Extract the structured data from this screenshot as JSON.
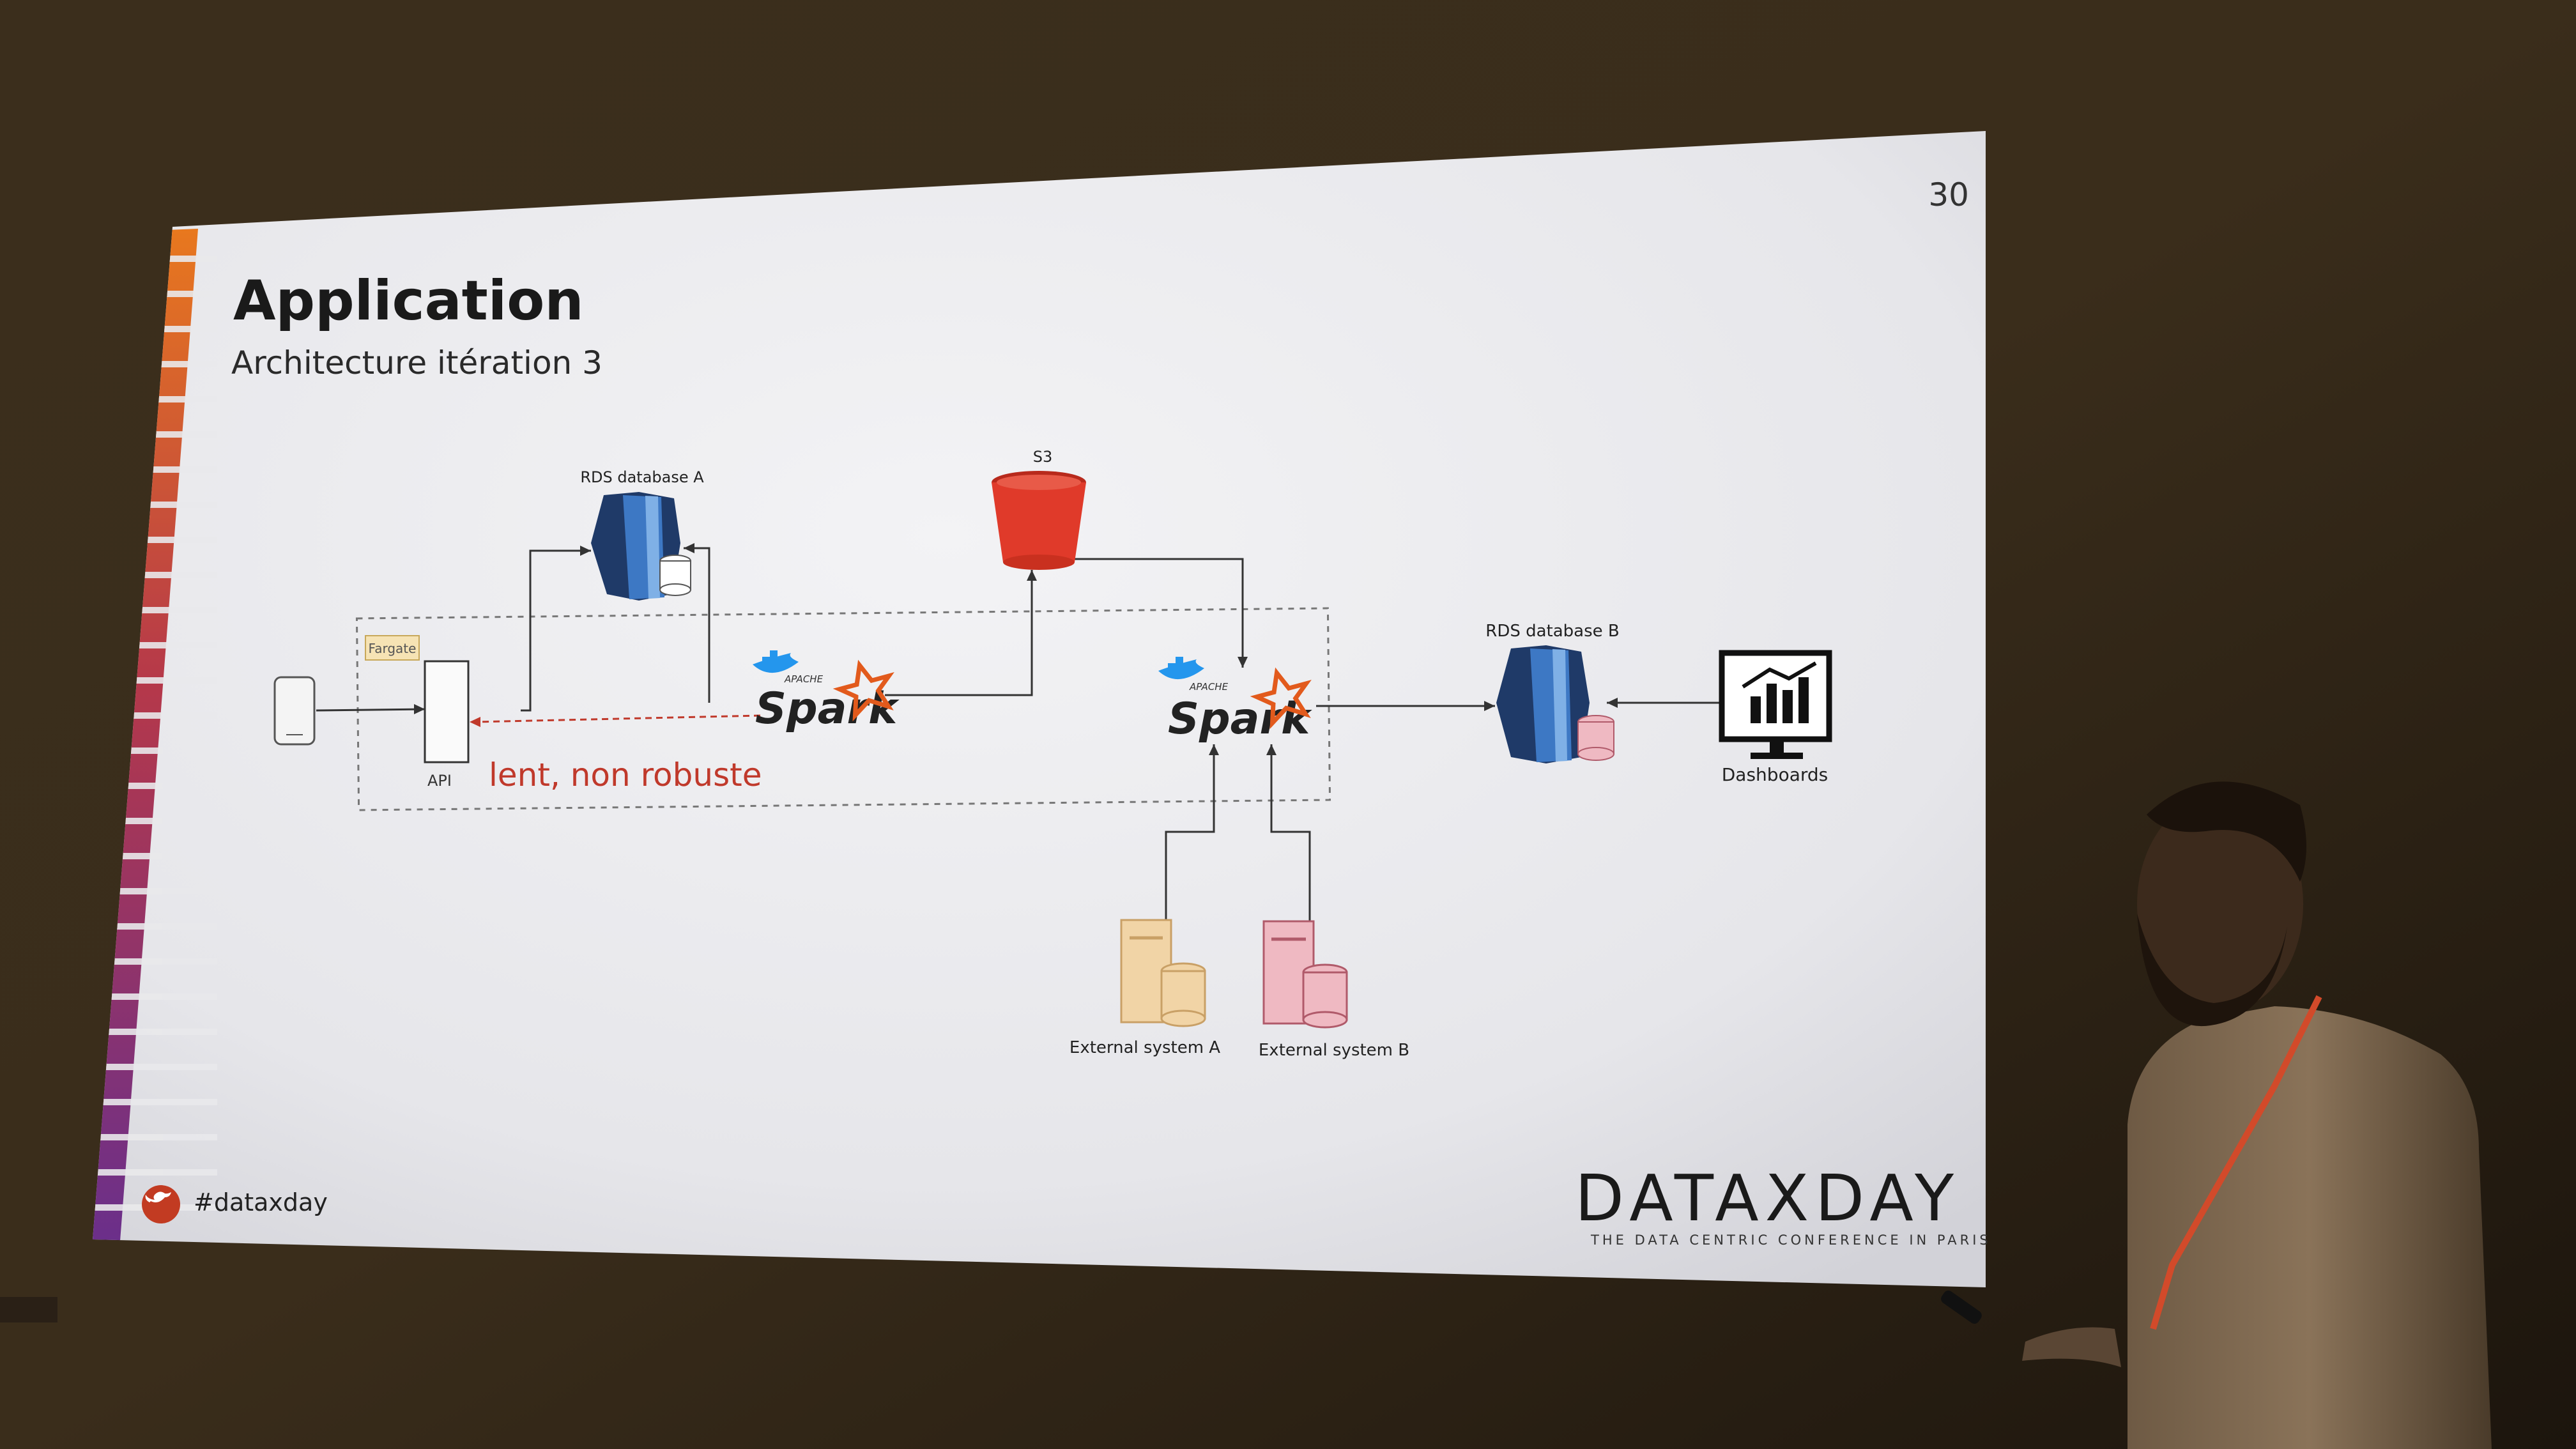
{
  "slide": {
    "page_number": "30",
    "title": "Application",
    "subtitle": "Architecture itération 3",
    "hashtag": "#dataxday",
    "brand_name": "DATAXDAY",
    "brand_tagline": "THE DATA CENTRIC CONFERENCE IN PARIS"
  },
  "diagram": {
    "rds_a_label": "RDS database A",
    "rds_b_label": "RDS database B",
    "s3_label": "S3",
    "fargate_label": "Fargate",
    "api_label": "API",
    "spark_apache": "APACHE",
    "spark_word": "Spark",
    "dashboards_label": "Dashboards",
    "external_a_label": "External system A",
    "external_b_label": "External system B",
    "annotation": "lent, non robuste"
  },
  "colors": {
    "slide_bg": "#e9e9ec",
    "annotation_red": "#c0392b",
    "s3_red": "#e03a2a",
    "spark_orange": "#e25a1c",
    "docker_blue": "#2496ed",
    "rds_navy": "#1f3a68",
    "rds_blue": "#3d78c4",
    "external_a_tan": "#f1d4a6",
    "external_b_pink": "#efb9c2",
    "twitter_badge": "#c23b22"
  }
}
